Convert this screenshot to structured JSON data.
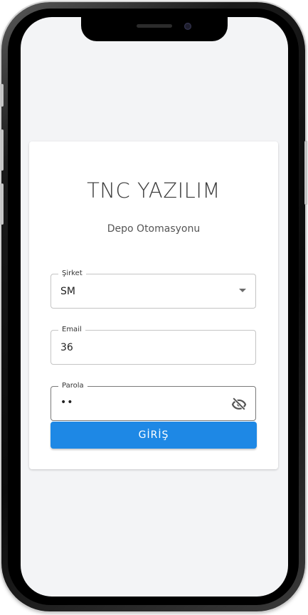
{
  "app": {
    "title": "TNC YAZILIM",
    "subtitle": "Depo Otomasyonu"
  },
  "form": {
    "company": {
      "label": "Şirket",
      "value": "SM",
      "icon": "chevron-down-icon"
    },
    "email": {
      "label": "Email",
      "value": "36"
    },
    "password": {
      "label": "Parola",
      "masked_value": "••",
      "visibility_icon": "eye-off-icon"
    },
    "submit_label": "GİRİŞ"
  },
  "colors": {
    "primary": "#1e88e5",
    "screen_background": "#f3f4f6",
    "card_background": "#ffffff",
    "field_border": "#c4c4c4"
  }
}
